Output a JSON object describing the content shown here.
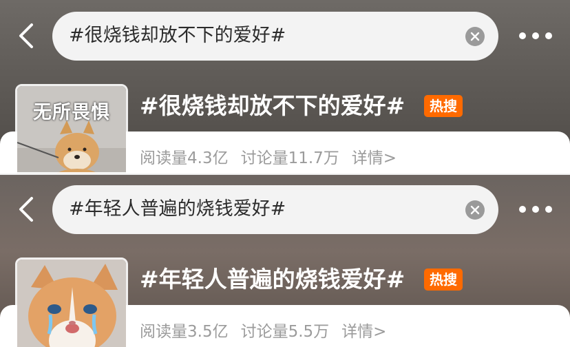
{
  "panels": [
    {
      "search": {
        "query": "#很烧钱却放不下的爱好#"
      },
      "topic": {
        "thumb_caption": "无所畏惧",
        "title": "#很烧钱却放不下的爱好#",
        "badge": "热搜",
        "reads": "阅读量4.3亿",
        "discussions": "讨论量11.7万",
        "details": "详情>"
      }
    },
    {
      "search": {
        "query": "#年轻人普遍的烧钱爱好#"
      },
      "topic": {
        "thumb_caption": "",
        "title": "#年轻人普遍的烧钱爱好#",
        "badge": "热搜",
        "reads": "阅读量3.5亿",
        "discussions": "讨论量5.5万",
        "details": "详情>"
      }
    }
  ],
  "icons": {
    "back": "chevron-left-icon",
    "clear": "clear-circle-x-icon",
    "more": "more-dots-icon",
    "thumb1": "shiba-dog-thumbnail",
    "thumb2": "orange-cat-thumbnail"
  },
  "colors": {
    "badge": "#ff6a00",
    "stats": "#9b9b9b",
    "search_bg": "#f3f3f3"
  }
}
